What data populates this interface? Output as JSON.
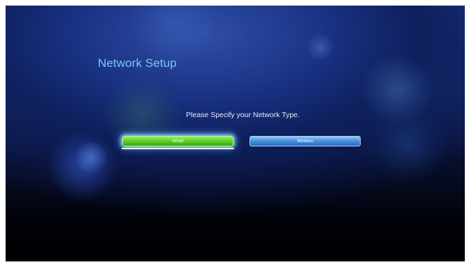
{
  "screen": {
    "title": "Network Setup",
    "prompt": "Please Specify your Network Type."
  },
  "options": [
    {
      "label": "Wired",
      "selected": true
    },
    {
      "label": "Wireless",
      "selected": false
    }
  ],
  "colors": {
    "title": "#7ec7f4",
    "selected_button": "#5fd22b",
    "unselected_button": "#4d93e0",
    "background_top": "#1c3a90",
    "background_bottom": "#000000"
  }
}
